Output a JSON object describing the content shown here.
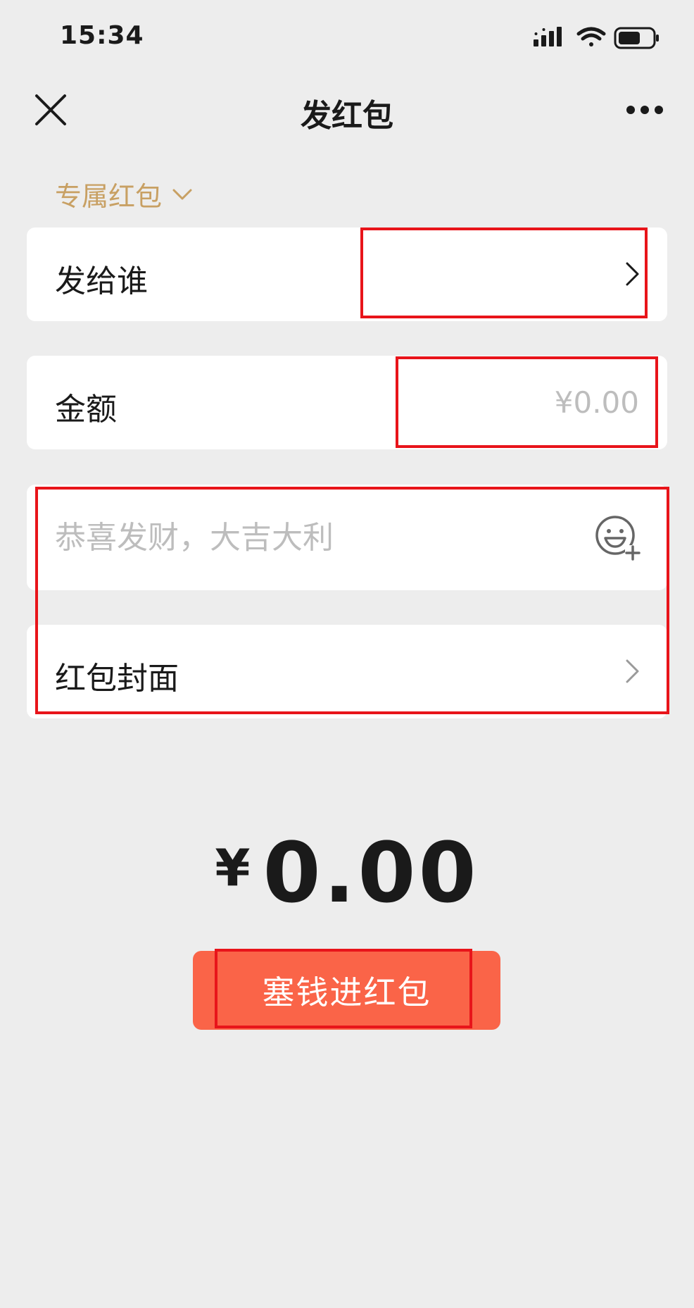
{
  "status_bar": {
    "time": "15:34"
  },
  "nav": {
    "title": "发红包"
  },
  "packet_type": {
    "label": "专属红包"
  },
  "recipient": {
    "label": "发给谁"
  },
  "amount": {
    "label": "金额",
    "placeholder": "¥0.00"
  },
  "greeting": {
    "placeholder": "恭喜发财，大吉大利"
  },
  "cover": {
    "label": "红包封面"
  },
  "total": {
    "currency": "¥",
    "value": "0.00"
  },
  "submit": {
    "label": "塞钱进红包"
  },
  "colors": {
    "background": "#ededed",
    "accent_gold": "#c8a063",
    "button": "#fa6448",
    "highlight_box": "#e8141a"
  },
  "icons": [
    "close-icon",
    "more-icon",
    "chevron-down-icon",
    "chevron-right-icon",
    "emoji-add-icon",
    "signal-icon",
    "wifi-icon",
    "battery-icon"
  ]
}
